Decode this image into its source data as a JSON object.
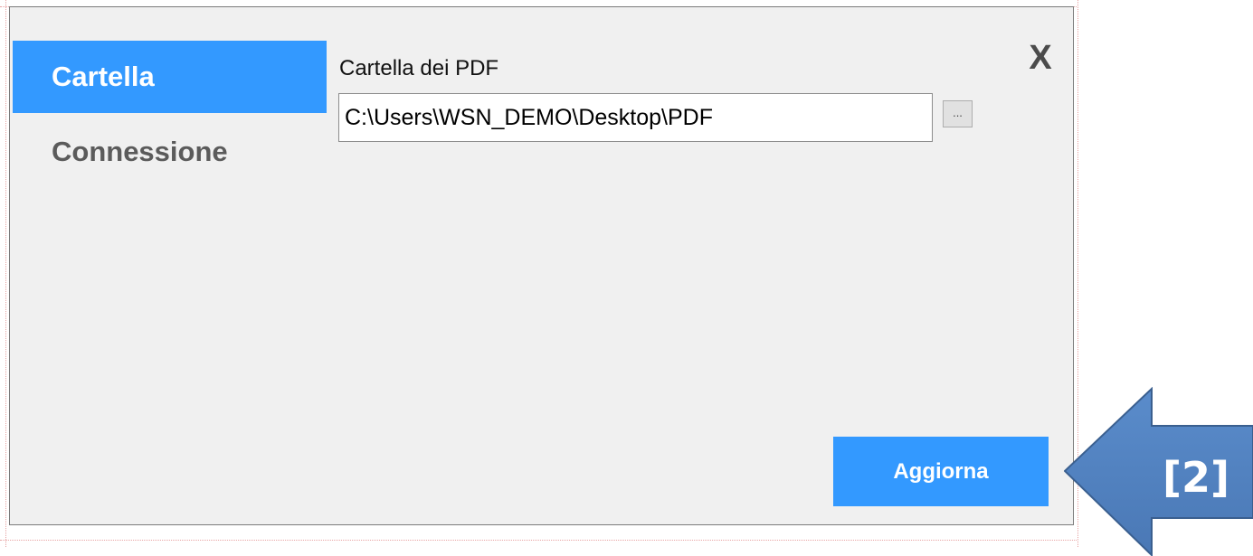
{
  "dialog": {
    "close_label": "X"
  },
  "nav": {
    "items": [
      {
        "label": "Cartella",
        "active": true
      },
      {
        "label": "Connessione",
        "active": false
      }
    ]
  },
  "folder": {
    "label": "Cartella dei PDF",
    "path_value": "C:\\Users\\WSN_DEMO\\Desktop\\PDF",
    "browse_label": "..."
  },
  "actions": {
    "update_label": "Aggiorna"
  },
  "callout": {
    "text": "[2]",
    "color": "#4f81bd"
  },
  "colors": {
    "accent": "#3399ff",
    "dialog_bg": "#f0f0f0",
    "close_x": "#4b4b4b"
  }
}
